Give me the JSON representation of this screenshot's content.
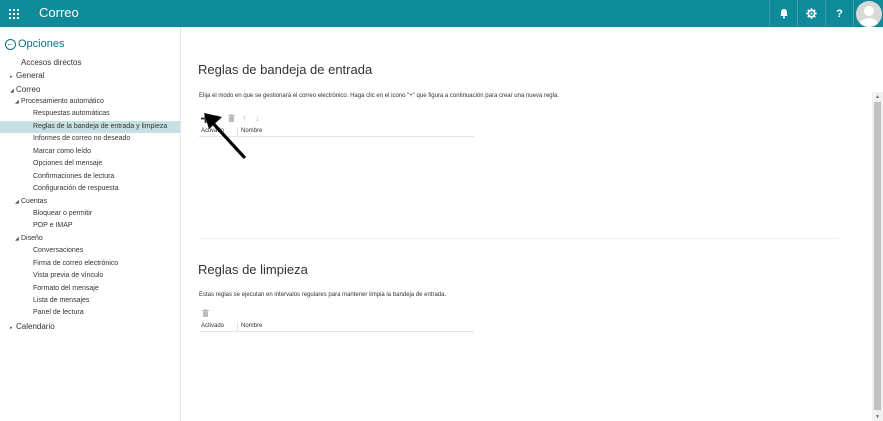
{
  "app": {
    "title": "Correo",
    "waffle_icon": "app-launcher-icon",
    "header_icons": [
      "bell-icon",
      "gear-icon",
      "help-icon",
      "avatar-icon"
    ],
    "help_glyph": "?",
    "brand_color": "#0f8a99"
  },
  "sidebar": {
    "title": "Opciones",
    "items": [
      {
        "label": "Accesos directos",
        "caret": ""
      },
      {
        "label": "General",
        "caret": "▸"
      },
      {
        "label": "Correo",
        "caret": "◢"
      },
      {
        "label": "Procesamiento automático",
        "caret": "◢"
      },
      {
        "label": "Respuestas automáticas",
        "caret": ""
      },
      {
        "label": "Reglas de la bandeja de entrada y limpieza",
        "caret": "",
        "selected": true
      },
      {
        "label": "Informes de correo no deseado",
        "caret": ""
      },
      {
        "label": "Marcar como leído",
        "caret": ""
      },
      {
        "label": "Opciones del mensaje",
        "caret": ""
      },
      {
        "label": "Confirmaciones de lectura",
        "caret": ""
      },
      {
        "label": "Configuración de respuesta",
        "caret": ""
      },
      {
        "label": "Cuentas",
        "caret": "◢"
      },
      {
        "label": "Bloquear o permitir",
        "caret": ""
      },
      {
        "label": "POP e IMAP",
        "caret": ""
      },
      {
        "label": "Diseño",
        "caret": "◢"
      },
      {
        "label": "Conversaciones",
        "caret": ""
      },
      {
        "label": "Firma de correo electrónico",
        "caret": ""
      },
      {
        "label": "Vista previa de vínculo",
        "caret": ""
      },
      {
        "label": "Formato del mensaje",
        "caret": ""
      },
      {
        "label": "Lista de mensajes",
        "caret": ""
      },
      {
        "label": "Panel de lectura",
        "caret": ""
      },
      {
        "label": "Calendario",
        "caret": "▸"
      }
    ]
  },
  "inbox_rules": {
    "title": "Reglas de bandeja de entrada",
    "description": "Elija el modo en que se gestionará el correo electrónico. Haga clic en el icono \"+\" que figura a continuación para crear una nueva regla.",
    "toolbar": {
      "add": "+",
      "edit": "✎",
      "delete": "🗑",
      "up": "↑",
      "down": "↓"
    },
    "columns": [
      "Activado",
      "Nombre"
    ]
  },
  "cleanup_rules": {
    "title": "Reglas de limpieza",
    "description": "Estas reglas se ejecutan en intervalos regulares para mantener limpia la bandeja de entrada.",
    "toolbar": {
      "delete": "🗑"
    },
    "columns": [
      "Activado",
      "Nombre"
    ]
  },
  "scrollbar": {
    "up": "▲",
    "down": "▼"
  }
}
